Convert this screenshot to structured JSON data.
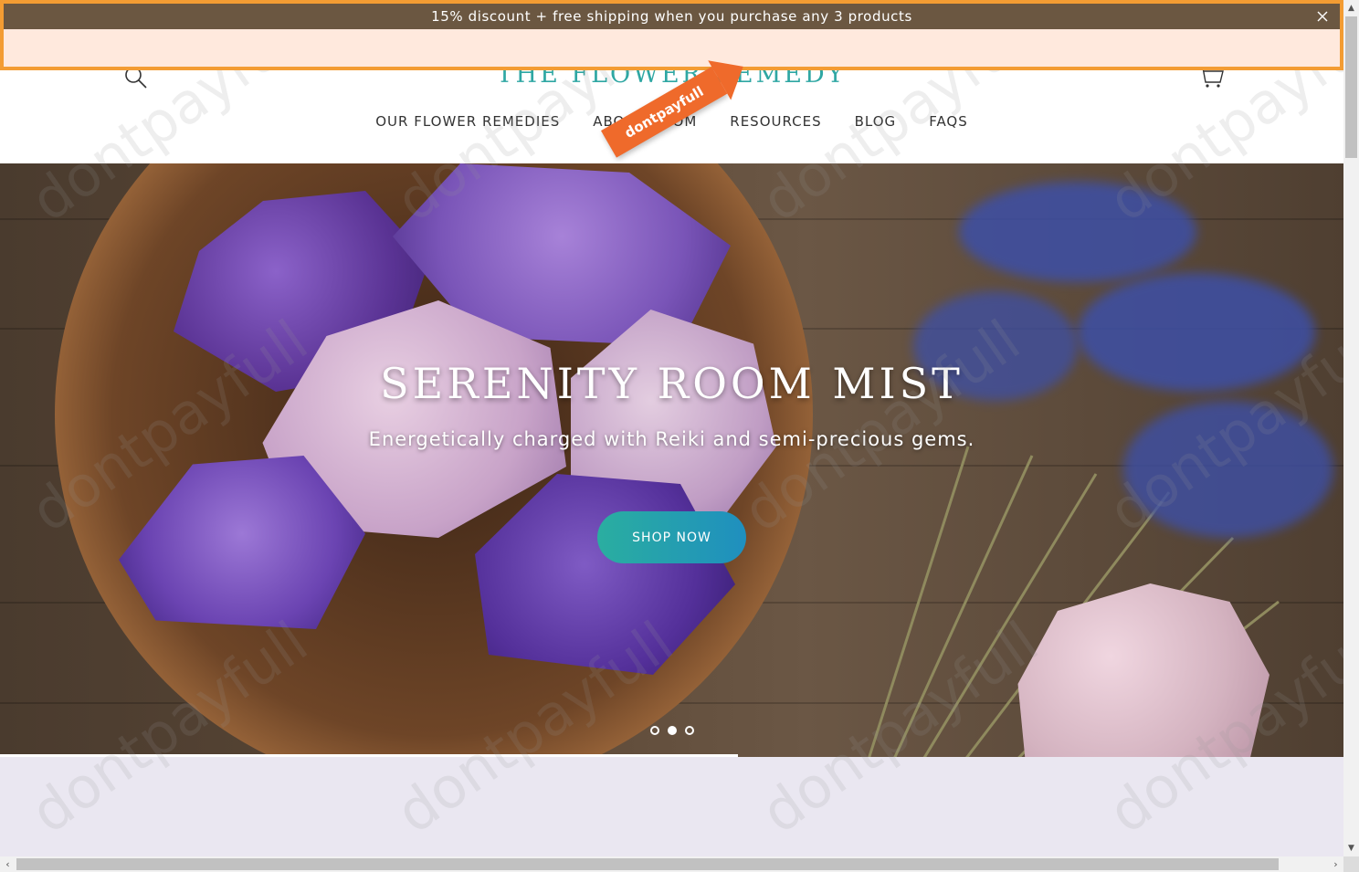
{
  "announcement": {
    "text": "15% discount + free shipping when you purchase any 3 products",
    "close_icon": "close-icon"
  },
  "header": {
    "logo": "THE FLOWER REMEDY",
    "search_icon": "search-icon",
    "cart_icon": "cart-icon",
    "nav": [
      {
        "label": "OUR FLOWER REMEDIES"
      },
      {
        "label": "ABOUT"
      },
      {
        "label": "ROOM"
      },
      {
        "label": "RESOURCES"
      },
      {
        "label": "BLOG"
      },
      {
        "label": "FAQS"
      }
    ]
  },
  "ribbon": {
    "text": "dontpayfull"
  },
  "hero": {
    "title": "SERENITY ROOM MIST",
    "subtitle": "Energetically charged with Reiki and semi-precious gems.",
    "button": "SHOP NOW",
    "slides": 3,
    "active_slide": 2
  },
  "watermark": {
    "text": "dontpayfull"
  },
  "colors": {
    "announcement_bar": "#6b5741",
    "overlay_border": "#f39c33",
    "logo": "#2fa7a3",
    "button_start": "#2aaea0",
    "button_end": "#1f8fbf",
    "ribbon": "#ef6a2b"
  }
}
